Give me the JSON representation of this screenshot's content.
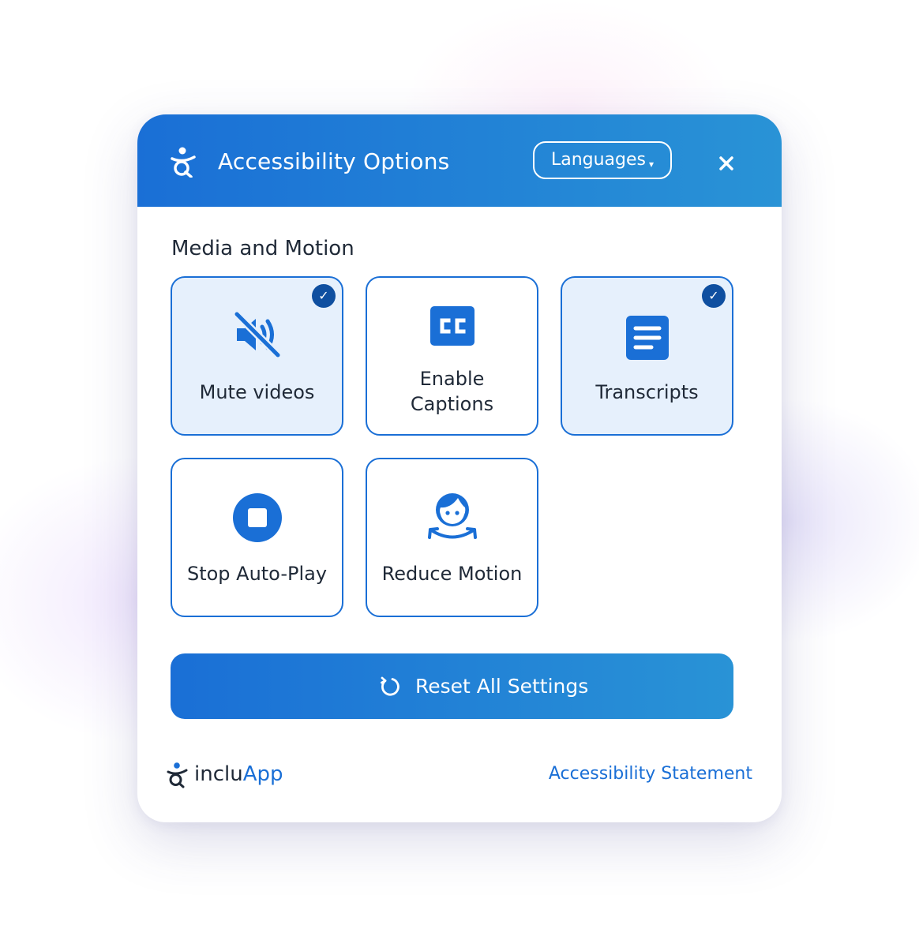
{
  "header": {
    "title": "Accessibility Options",
    "languages_label": "Languages",
    "caret": "▾",
    "logo_icon": "accessibility-person-icon",
    "close_icon": "close-icon"
  },
  "section": {
    "title": "Media and Motion"
  },
  "options": [
    {
      "label": "Mute videos",
      "icon": "mute-video-icon",
      "active": true
    },
    {
      "label": "Enable",
      "label2": "Captions",
      "icon": "closed-captions-icon",
      "active": false
    },
    {
      "label": "Transcripts",
      "icon": "transcript-document-icon",
      "active": true
    },
    {
      "label": "Stop Auto-Play",
      "icon": "stop-icon",
      "active": false
    },
    {
      "label": "Reduce Motion",
      "icon": "reduce-motion-face-icon",
      "active": false
    }
  ],
  "check_mark": "✓",
  "reset": {
    "label": "Reset All Settings",
    "icon": "reset-icon"
  },
  "footer": {
    "brand_prefix": "inclu",
    "brand_suffix": "App",
    "statement_link": "Accessibility Statement"
  },
  "colors": {
    "primary": "#1a6fd6",
    "primary_light": "#2993d6",
    "active_bg": "#e6f0fc",
    "check_bg": "#0f4fa0",
    "text": "#1f2937"
  }
}
